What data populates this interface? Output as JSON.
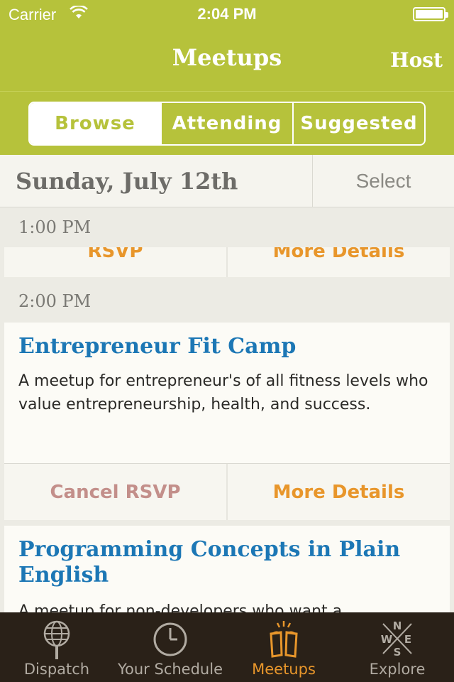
{
  "status_bar": {
    "carrier": "Carrier",
    "time": "2:04 PM"
  },
  "nav": {
    "title": "Meetups",
    "host_label": "Host"
  },
  "segments": [
    {
      "label": "Browse",
      "active": true
    },
    {
      "label": "Attending",
      "active": false
    },
    {
      "label": "Suggested",
      "active": false
    }
  ],
  "date_header": {
    "date": "Sunday, July 12th",
    "select_label": "Select"
  },
  "list": {
    "groups": [
      {
        "time": "1:00 PM",
        "partial_actions": {
          "left": "RSVP",
          "right": "More Details"
        }
      },
      {
        "time": "2:00 PM",
        "meetups": [
          {
            "title": "Entrepreneur Fit Camp",
            "description": "A meetup for entrepreneur's of all fitness levels who value entrepreneurship, health, and success.",
            "left_action": "Cancel RSVP",
            "right_action": "More Details"
          },
          {
            "title": "Programming Concepts in Plain English",
            "description": "A meetup for non-developers who want a"
          }
        ]
      }
    ]
  },
  "tabs": [
    {
      "label": "Dispatch",
      "icon": "microphone-globe-icon",
      "active": false
    },
    {
      "label": "Your Schedule",
      "icon": "clock-icon",
      "active": false
    },
    {
      "label": "Meetups",
      "icon": "beer-cheers-icon",
      "active": true
    },
    {
      "label": "Explore",
      "icon": "compass-icon",
      "active": false
    }
  ],
  "colors": {
    "header_green": "#b6c23b",
    "link_blue": "#1c77b5",
    "accent_orange": "#e8962b",
    "cancel_rose": "#c38f8a",
    "tabbar_bg": "#2a2118"
  }
}
